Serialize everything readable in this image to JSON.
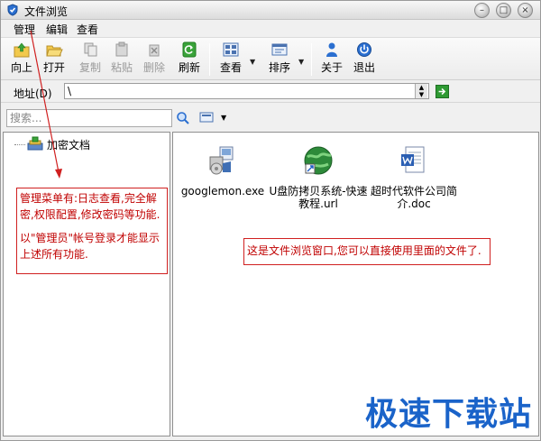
{
  "window": {
    "title": "文件浏览"
  },
  "menubar": {
    "items": [
      "管理",
      "编辑",
      "查看"
    ]
  },
  "toolbar": {
    "up": "向上",
    "open": "打开",
    "copy": "复制",
    "paste": "粘贴",
    "delete": "删除",
    "refresh": "刷新",
    "view": "查看",
    "sort": "排序",
    "about": "关于",
    "exit": "退出"
  },
  "address": {
    "label": "地址(D)",
    "value": "\\"
  },
  "search": {
    "placeholder": "搜索..."
  },
  "tree": {
    "root_label": "加密文档"
  },
  "files": [
    {
      "name": "googlemon.exe",
      "icon": "installer-icon"
    },
    {
      "name": "U盘防拷贝系统-快速教程.url",
      "icon": "url-icon"
    },
    {
      "name": "超时代软件公司简介.doc",
      "icon": "doc-icon"
    }
  ],
  "annotations": {
    "menu_note_line1": "管理菜单有:日志查看,完全解密,权限配置,修改密码等功能.",
    "menu_note_line2": "以\"管理员\"帐号登录才能显示上述所有功能.",
    "window_note": "这是文件浏览窗口,您可以直接使用里面的文件了."
  },
  "watermark": "极速下载站",
  "colors": {
    "note_border": "#d02020",
    "note_text": "#c00000",
    "watermark": "#1a63c9"
  }
}
